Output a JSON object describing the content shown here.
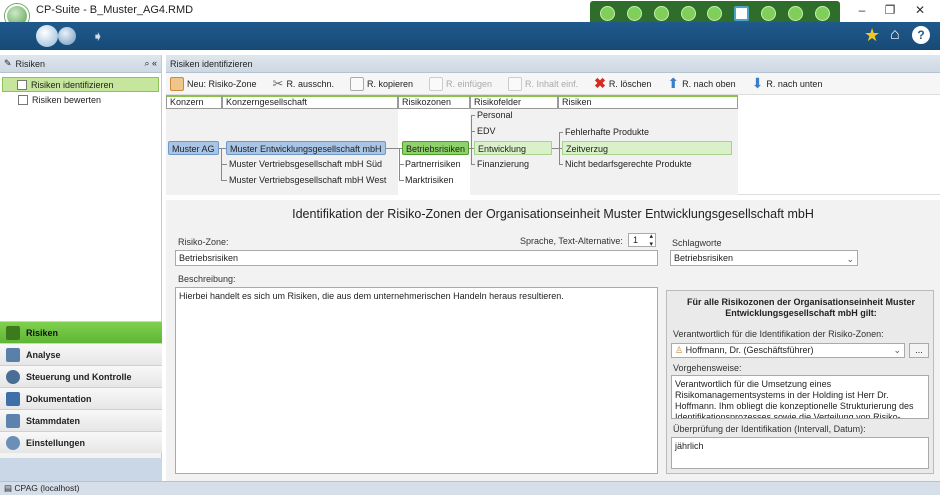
{
  "window": {
    "title": "CP-Suite - B_Muster_AG4.RMD"
  },
  "sidebar": {
    "header": "Risiken",
    "tree": [
      {
        "label": "Risiken identifizieren",
        "selected": true
      },
      {
        "label": "Risiken bewerten",
        "selected": false
      }
    ],
    "nav": [
      {
        "label": "Risiken",
        "active": true,
        "icon": "pencil-icon"
      },
      {
        "label": "Analyse",
        "active": false,
        "icon": "analysis-icon"
      },
      {
        "label": "Steuerung und Kontrolle",
        "active": false,
        "icon": "control-icon"
      },
      {
        "label": "Dokumentation",
        "active": false,
        "icon": "documentation-icon"
      },
      {
        "label": "Stammdaten",
        "active": false,
        "icon": "master-data-icon"
      },
      {
        "label": "Einstellungen",
        "active": false,
        "icon": "settings-icon"
      }
    ]
  },
  "main": {
    "header": "Risiken identifizieren",
    "toolbar": [
      {
        "label": "Neu: Risiko-Zone",
        "icon": "new-zone-icon",
        "disabled": false
      },
      {
        "label": "R. ausschn.",
        "icon": "scissors-icon",
        "disabled": false
      },
      {
        "label": "R. kopieren",
        "icon": "copy-icon",
        "disabled": false
      },
      {
        "label": "R. einfügen",
        "icon": "paste-icon",
        "disabled": true
      },
      {
        "label": "R. Inhalt einf.",
        "icon": "paste-content-icon",
        "disabled": true
      },
      {
        "label": "R. löschen",
        "icon": "delete-icon",
        "disabled": false
      },
      {
        "label": "R. nach oben",
        "icon": "arrow-up-icon",
        "disabled": false
      },
      {
        "label": "R. nach unten",
        "icon": "arrow-down-icon",
        "disabled": false
      }
    ],
    "hierarchy": {
      "columns": [
        "Konzern",
        "Konzerngesellschaft",
        "Risikozonen",
        "Risikofelder",
        "Risiken"
      ],
      "konzern": "Muster AG",
      "gesellschaften": [
        "Muster Entwicklungsgesellschaft mbH",
        "Muster Vertriebsgesellschaft mbH Süd",
        "Muster Vertriebsgesellschaft mbH West"
      ],
      "zonen": [
        "Betriebsrisiken",
        "Partnerrisiken",
        "Marktrisiken"
      ],
      "felder": [
        "Personal",
        "EDV",
        "Entwicklung",
        "Finanzierung"
      ],
      "risiken": [
        "Fehlerhafte Produkte",
        "Zeitverzug",
        "Nicht bedarfsgerechte Produkte"
      ]
    },
    "form": {
      "title": "Identifikation der Risiko-Zonen der Organisationseinheit Muster Entwicklungsgesellschaft mbH",
      "zone_label": "Risiko-Zone:",
      "zone_value": "Betriebsrisiken",
      "sprache_label": "Sprache, Text-Alternative:",
      "sprache_value": "1",
      "schlagworte_label": "Schlagworte",
      "schlagworte_value": "Betriebsrisiken",
      "beschreibung_label": "Beschreibung:",
      "beschreibung_value": "Hierbei handelt es sich um Risiken, die aus dem unternehmerischen Handeln heraus resultieren."
    },
    "panel": {
      "heading": "Für alle Risikozonen der Organisationseinheit Muster Entwicklungsgesellschaft mbH gilt:",
      "verantwortlich_label": "Verantwortlich für die Identifikation der Risiko-Zonen:",
      "verantwortlich_value": "Hoffmann, Dr. (Geschäftsführer)",
      "more_button": "...",
      "vorgehen_label": "Vorgehensweise:",
      "vorgehen_value": "Verantwortlich für die Umsetzung eines Risikomanagementsystems in der Holding ist Herr Dr. Hoffmann. Ihm obliegt die konzeptionelle Strukturierung des Identifikationsprozesses sowie die Verteilung von Risiko-",
      "ueberpruefung_label": "Überprüfung der Identifikation (Intervall, Datum):",
      "ueberpruefung_value": "jährlich"
    }
  },
  "statusbar": {
    "text": "CPAG (localhost)"
  },
  "colors": {
    "accent_green": "#5fb535",
    "navbar_blue": "#1f5a8c",
    "node_blue": "#a9c5e6",
    "node_green": "#8fd16a"
  }
}
